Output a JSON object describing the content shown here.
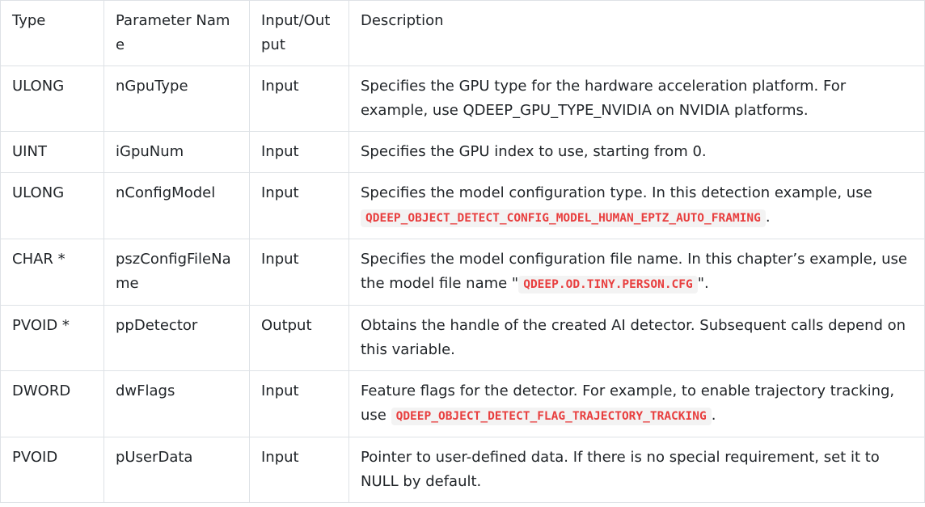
{
  "headers": [
    "Type",
    "Parameter Name",
    "Input/Output",
    "Description"
  ],
  "rows": [
    {
      "type": "ULONG",
      "name": "nGpuType",
      "io": "Input",
      "desc_before": "Specifies the GPU type for the hardware acceleration platform. For example, use QDEEP_GPU_TYPE_NVIDIA on NVIDIA platforms.",
      "desc_code": "",
      "desc_after": ""
    },
    {
      "type": "UINT",
      "name": "iGpuNum",
      "io": "Input",
      "desc_before": "Specifies the GPU index to use, starting from 0.",
      "desc_code": "",
      "desc_after": ""
    },
    {
      "type": "ULONG",
      "name": "nConfigModel",
      "io": "Input",
      "desc_before": "Specifies the model configuration type. In this detection example, use ",
      "desc_code": "QDEEP_OBJECT_DETECT_CONFIG_MODEL_HUMAN_EPTZ_AUTO_FRAMING",
      "desc_after": "."
    },
    {
      "type": "CHAR *",
      "name": "pszConfigFileName",
      "io": "Input",
      "desc_before": "Specifies the model configuration file name. In this chapter’s example, use the model file name \"",
      "desc_code": "QDEEP.OD.TINY.PERSON.CFG",
      "desc_after": "\"."
    },
    {
      "type": "PVOID *",
      "name": "ppDetector",
      "io": "Output",
      "desc_before": "Obtains the handle of the created AI detector. Subsequent calls depend on this variable.",
      "desc_code": "",
      "desc_after": ""
    },
    {
      "type": "DWORD",
      "name": "dwFlags",
      "io": "Input",
      "desc_before": "Feature flags for the detector. For example, to enable trajectory tracking, use ",
      "desc_code": "QDEEP_OBJECT_DETECT_FLAG_TRAJECTORY_TRACKING",
      "desc_after": "."
    },
    {
      "type": "PVOID",
      "name": "pUserData",
      "io": "Input",
      "desc_before": "Pointer to user-defined data. If there is no special requirement, set it to NULL by default.",
      "desc_code": "",
      "desc_after": ""
    }
  ]
}
